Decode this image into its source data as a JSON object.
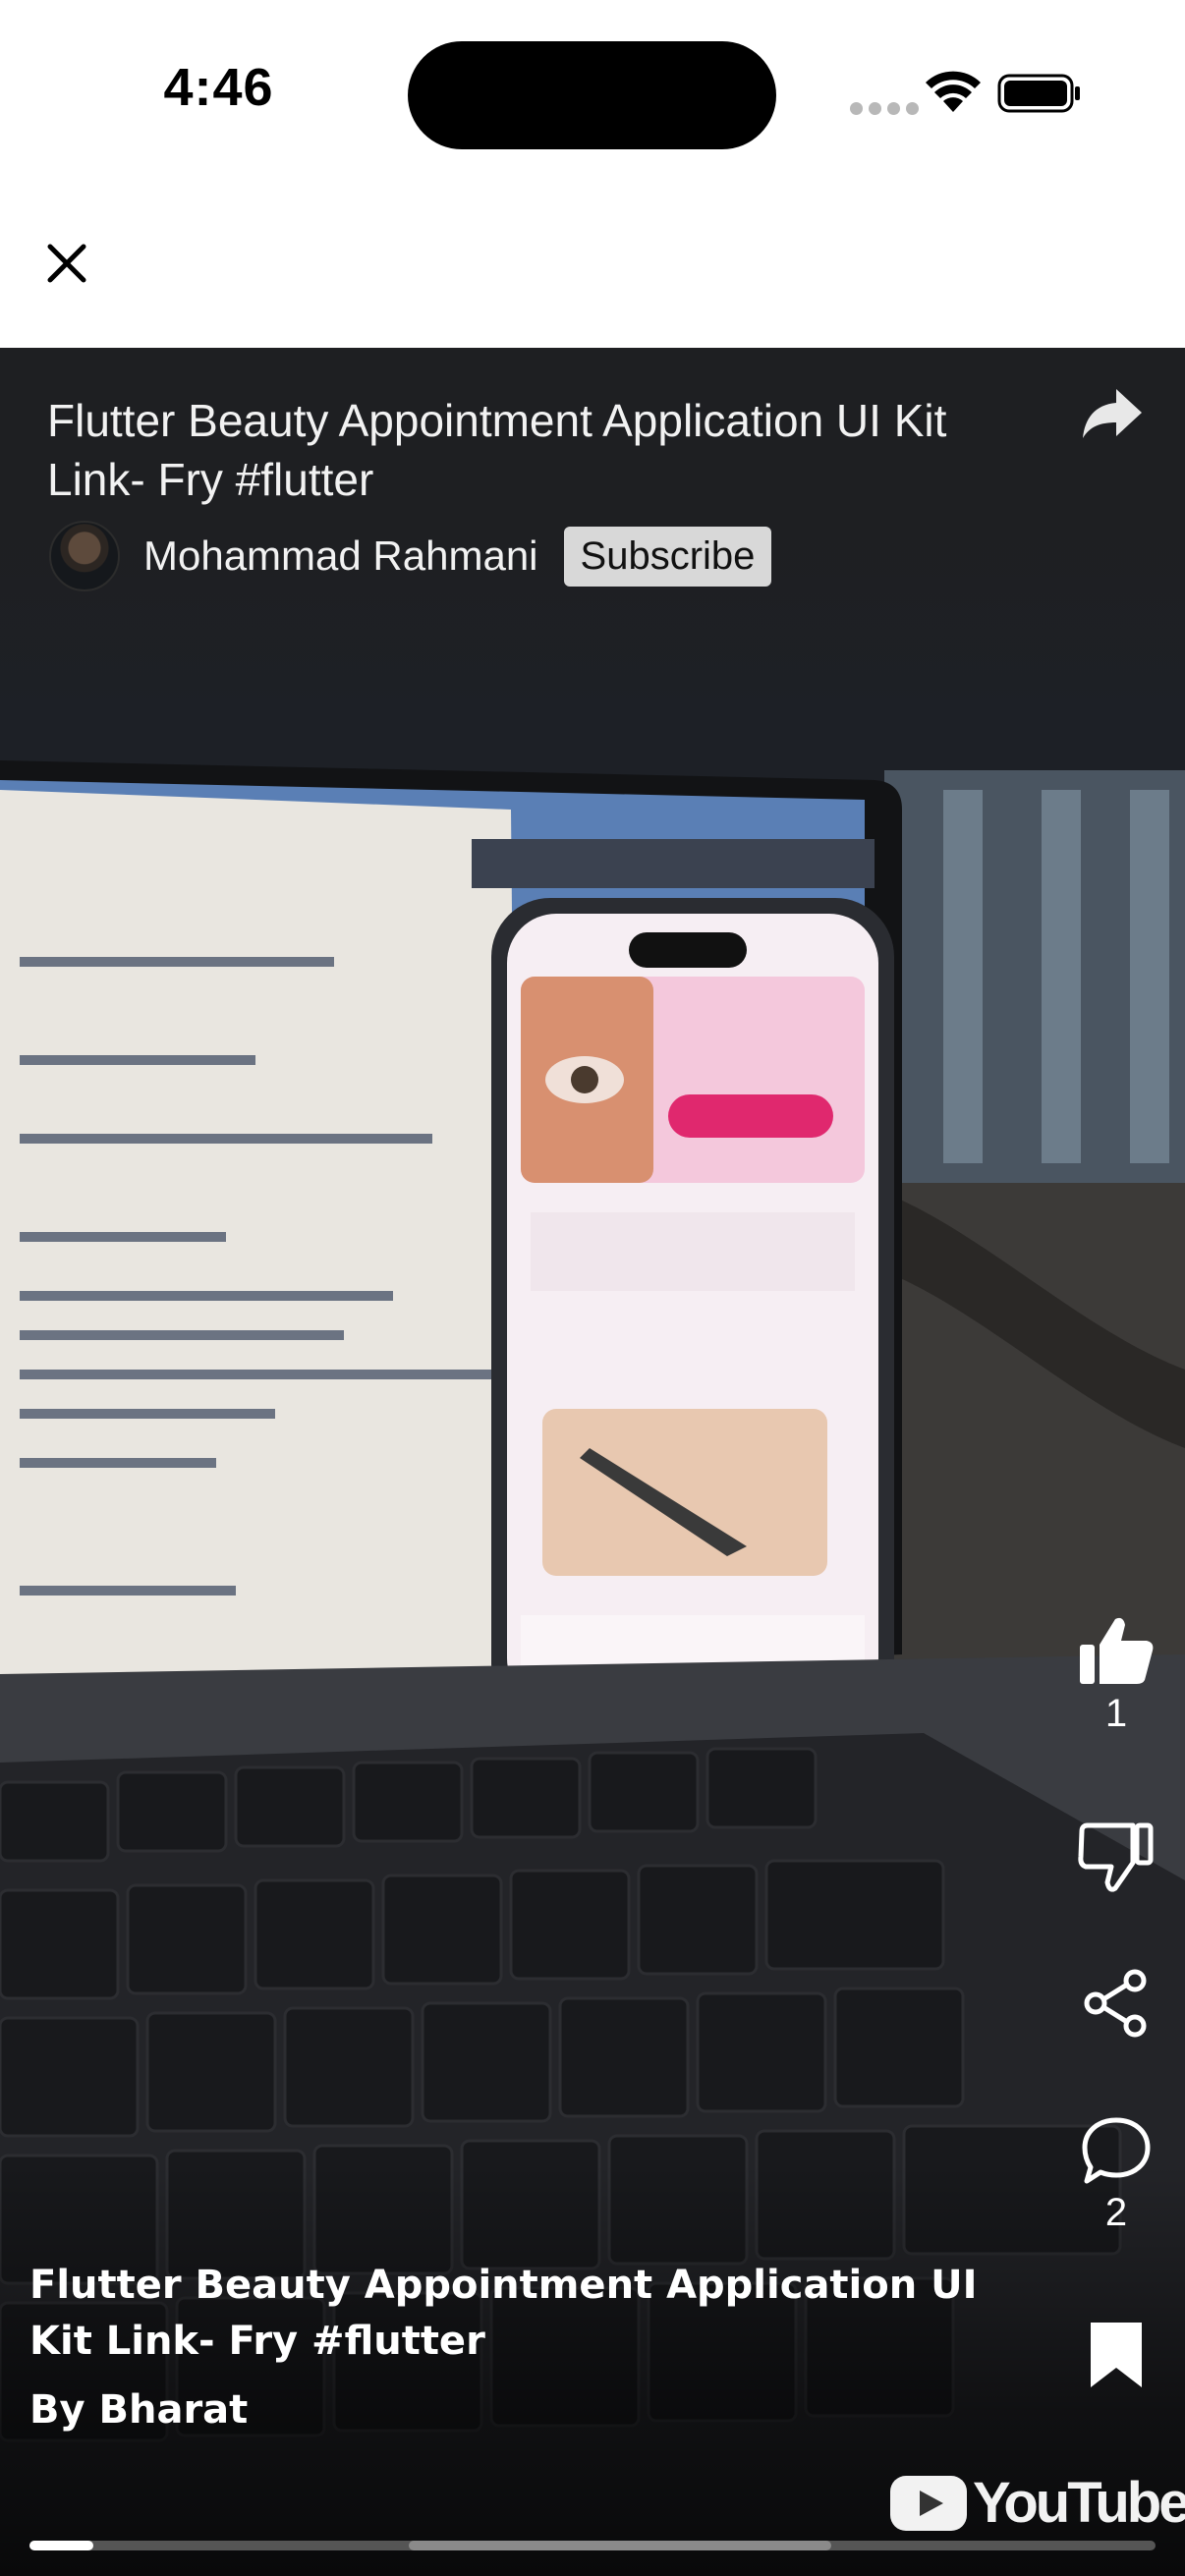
{
  "status_bar": {
    "time": "4:46"
  },
  "sheet": {
    "close_icon": "close-icon"
  },
  "video": {
    "title": "Flutter Beauty Appointment Application UI Kit Link- Fry #flutter",
    "channel_name": "Mohammad Rahmani",
    "subscribe_label": "Subscribe",
    "watermark": "YouTube",
    "progress_fraction": 0.057,
    "buffer_fraction": 0.375
  },
  "actions": {
    "like_count": "1",
    "comment_count": "2",
    "icons": [
      "share-icon",
      "thumbs-up-icon",
      "thumbs-down-icon",
      "network-share-icon",
      "comment-icon",
      "bookmark-icon"
    ]
  },
  "caption": {
    "title": "Flutter Beauty Appointment Application UI Kit Link- Fry #flutter",
    "author": "By Bharat"
  },
  "colors": {
    "video_background": "#1b1d22",
    "overlay_text": "#ffffff",
    "subscribe_bg": "#d8d8d8"
  }
}
